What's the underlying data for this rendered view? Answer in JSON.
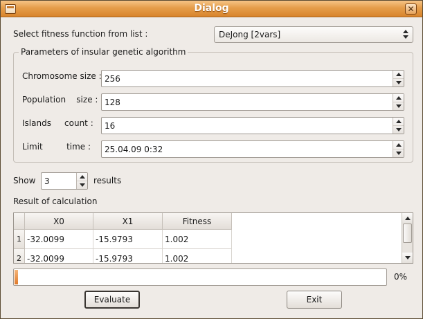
{
  "window": {
    "title": "Dialog"
  },
  "fitness": {
    "label": "Select fitness function from list :",
    "selected": "DeJong [2vars]"
  },
  "params": {
    "group_title": "Parameters of insular genetic algorithm",
    "rows": [
      {
        "label": "Chromosome size :",
        "value": "256"
      },
      {
        "label": "Population    size :",
        "value": "128"
      },
      {
        "label": "Islands     count :",
        "value": "16"
      },
      {
        "label": "Limit         time :",
        "value": "25.04.09 0:32"
      }
    ]
  },
  "show": {
    "prefix": "Show",
    "value": "3",
    "suffix": "results"
  },
  "results": {
    "title": "Result of calculation",
    "columns": [
      "X0",
      "X1",
      "Fitness"
    ],
    "rows": [
      {
        "index": "1",
        "cells": [
          "-32.0099",
          "-15.9793",
          "1.002"
        ]
      },
      {
        "index": "2",
        "cells": [
          "-32.0099",
          "-15.9793",
          "1.002"
        ]
      }
    ]
  },
  "progress": {
    "value": 0,
    "label": "0%"
  },
  "buttons": {
    "evaluate": "Evaluate",
    "exit": "Exit"
  }
}
